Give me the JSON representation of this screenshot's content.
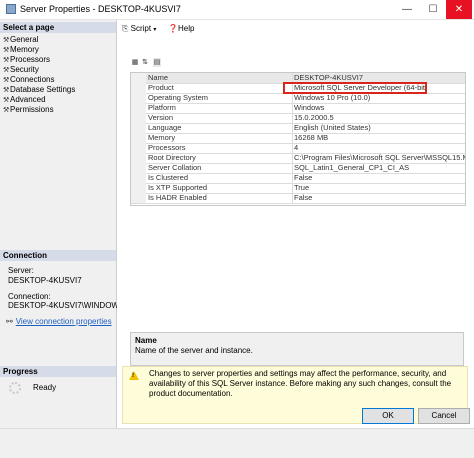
{
  "window": {
    "title": "Server Properties - DESKTOP-4KUSVI7",
    "min_glyph": "—",
    "max_glyph": "☐",
    "close_glyph": "✕"
  },
  "left_panel": {
    "select_page_header": "Select a page",
    "pages": [
      {
        "label": "General",
        "icon": "wrench-icon"
      },
      {
        "label": "Memory",
        "icon": "wrench-icon"
      },
      {
        "label": "Processors",
        "icon": "wrench-icon"
      },
      {
        "label": "Security",
        "icon": "wrench-icon"
      },
      {
        "label": "Connections",
        "icon": "wrench-icon"
      },
      {
        "label": "Database Settings",
        "icon": "wrench-icon"
      },
      {
        "label": "Advanced",
        "icon": "wrench-icon"
      },
      {
        "label": "Permissions",
        "icon": "wrench-icon"
      }
    ],
    "connection_header": "Connection",
    "server_label": "Server:",
    "server_value": "DESKTOP-4KUSVI7",
    "connection_label": "Connection:",
    "connection_value": "DESKTOP-4KUSVI7\\WINDOWS",
    "view_conn_link": "View connection properties",
    "progress_header": "Progress",
    "progress_status": "Ready"
  },
  "toolbar": {
    "script_label": "Script",
    "help_label": "Help"
  },
  "properties": [
    {
      "name": "Name",
      "value": "DESKTOP-4KUSVI7"
    },
    {
      "name": "Product",
      "value": "Microsoft SQL Server Developer (64-bit)"
    },
    {
      "name": "Operating System",
      "value": "Windows 10 Pro (10.0)"
    },
    {
      "name": "Platform",
      "value": "Windows"
    },
    {
      "name": "Version",
      "value": "15.0.2000.5"
    },
    {
      "name": "Language",
      "value": "English (United States)"
    },
    {
      "name": "Memory",
      "value": "16268 MB"
    },
    {
      "name": "Processors",
      "value": "4"
    },
    {
      "name": "Root Directory",
      "value": "C:\\Program Files\\Microsoft SQL Server\\MSSQL15.MS"
    },
    {
      "name": "Server Collation",
      "value": "SQL_Latin1_General_CP1_CI_AS"
    },
    {
      "name": "Is Clustered",
      "value": "False"
    },
    {
      "name": "Is XTP Supported",
      "value": "True"
    },
    {
      "name": "Is HADR Enabled",
      "value": "False"
    }
  ],
  "description": {
    "title": "Name",
    "text": "Name of the server and instance."
  },
  "warning": {
    "text": "Changes to server properties and settings may affect the performance, security, and availability of this SQL Server instance. Before making any such changes, consult the product documentation."
  },
  "buttons": {
    "ok": "OK",
    "cancel": "Cancel"
  },
  "colors": {
    "highlight_box": "#d9261c",
    "section_header": "#d6dbe9",
    "warning_bg": "#fffcd9"
  }
}
